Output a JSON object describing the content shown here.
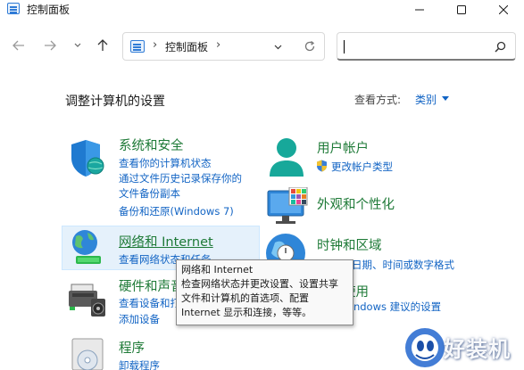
{
  "window": {
    "title": "控制面板",
    "controls": [
      "minimize-icon",
      "maximize-icon",
      "close-icon"
    ]
  },
  "nav": {
    "breadcrumb": "控制面板",
    "breadcrumb_sep": "›",
    "search_value": "",
    "icons": [
      "back-arrow-icon",
      "forward-arrow-icon",
      "recent-chevron-icon",
      "up-arrow-icon",
      "refresh-icon",
      "search-icon"
    ]
  },
  "heading": {
    "title": "调整计算机的设置",
    "view_by_label": "查看方式:",
    "view_by_value": "类别"
  },
  "categories": [
    {
      "title": "系统和安全",
      "icon": "shield-icon",
      "links": [
        "查看你的计算机状态",
        "通过文件历史记录保存你的",
        "文件备份副本",
        "备份和还原(Windows 7)"
      ]
    },
    {
      "title": "网络和 Internet",
      "icon": "network-globe-icon",
      "links": [
        "查看网络状态和任务"
      ]
    },
    {
      "title": "硬件和声音",
      "icon": "printer-speaker-icon",
      "links": [
        "查看设备和打印机",
        "添加设备"
      ]
    },
    {
      "title": "程序",
      "icon": "programs-disc-icon",
      "links": [
        "卸载程序"
      ]
    },
    {
      "title": "用户帐户",
      "icon": "user-account-icon",
      "links": [
        "更改帐户类型"
      ],
      "link_icon": "uac-shield-icon"
    },
    {
      "title": "外观和个性化",
      "icon": "monitor-palette-icon",
      "links": []
    },
    {
      "title": "时钟和区域",
      "icon": "clock-globe-icon",
      "links": [
        "更改日期、时间或数字格式"
      ]
    },
    {
      "title": "轻松使用",
      "icon": "ease-of-access-icon",
      "links": [
        "使用 Windows 建议的设置"
      ]
    }
  ],
  "tooltip": {
    "title": "网络和 Internet",
    "lines": [
      "检查网络状态并更改设置、设置共享",
      "文件和计算机的首选项、配置",
      "Internet 显示和连接，等等。"
    ]
  },
  "watermark": {
    "text": "好装机",
    "logo": "watermark-logo-icon"
  },
  "colors": {
    "category_title": "#1e7a37",
    "link": "#1264c4",
    "hover_bg": "#e5f1fb"
  }
}
